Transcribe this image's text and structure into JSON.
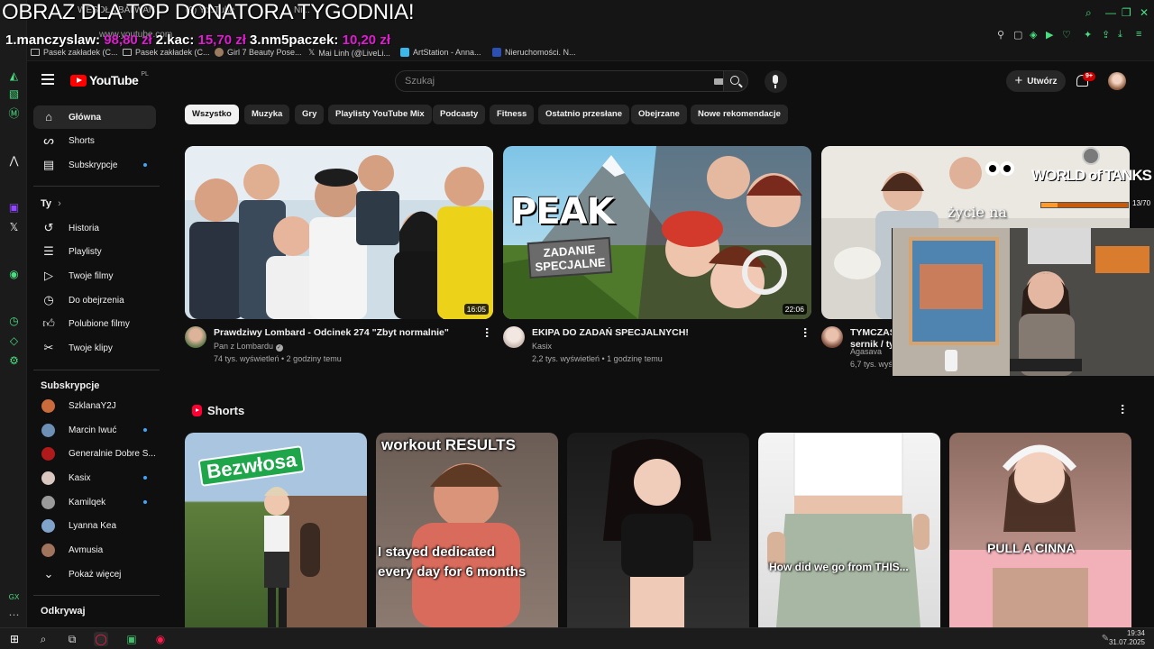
{
  "overlay": {
    "title": "OBRAZ DLA TOP DONATORA TYGODNIA!",
    "donors": [
      {
        "rank": "1.",
        "name": "manczyslaw:",
        "amount": "98,80 zł"
      },
      {
        "rank": "2.",
        "name": "kac:",
        "amount": "15,70 zł"
      },
      {
        "rank": "3.",
        "name": "nm5paczek:",
        "amount": "10,20 zł"
      }
    ]
  },
  "browser": {
    "url": "www.youtube.com",
    "tabs": [
      "WESOŁA BALWAN",
      "(9) YouTube",
      "Ni..."
    ],
    "bookmarks": [
      {
        "label": "Pasek zakładek (C...",
        "icon": "folder-icon"
      },
      {
        "label": "Pasek zakładek (C...",
        "icon": "folder-icon"
      },
      {
        "label": "Girl 7 Beauty Pose...",
        "icon": "site-icon"
      },
      {
        "label": "Mai Linh (@LiveLi...",
        "icon": "x-icon"
      },
      {
        "label": "ArtStation - Anna...",
        "icon": "artstation-icon"
      },
      {
        "label": "Nieruchomości. N...",
        "icon": "m-icon"
      }
    ]
  },
  "header": {
    "logo_text": "YouTube",
    "country": "PL",
    "search_placeholder": "Szukaj",
    "create_label": "Utwórz",
    "notif_badge": "9+"
  },
  "sidebar": {
    "main": [
      {
        "label": "Główna",
        "icon": "home-icon",
        "active": true
      },
      {
        "label": "Shorts",
        "icon": "shorts-icon"
      },
      {
        "label": "Subskrypcje",
        "icon": "subscriptions-icon",
        "dot": true
      }
    ],
    "you_heading": "Ty",
    "you": [
      {
        "label": "Historia",
        "icon": "history-icon"
      },
      {
        "label": "Playlisty",
        "icon": "playlist-icon"
      },
      {
        "label": "Twoje filmy",
        "icon": "your-videos-icon"
      },
      {
        "label": "Do obejrzenia",
        "icon": "watch-later-icon"
      },
      {
        "label": "Polubione filmy",
        "icon": "like-icon"
      },
      {
        "label": "Twoje klipy",
        "icon": "clips-icon"
      }
    ],
    "subs_heading": "Subskrypcje",
    "subs": [
      {
        "label": "SzklanaY2J",
        "color": "#c96b3b"
      },
      {
        "label": "Marcin Iwuć",
        "color": "#6e8fb5",
        "dot": true
      },
      {
        "label": "Generalnie Dobre S...",
        "color": "#b11a1a"
      },
      {
        "label": "Kasix",
        "color": "#d9c7c0",
        "dot": true
      },
      {
        "label": "Kamilqek",
        "color": "#9a9a9a",
        "dot": true
      },
      {
        "label": "Lyanna Kea",
        "color": "#7fa3c9"
      },
      {
        "label": "Avmusia",
        "color": "#a0735c"
      }
    ],
    "show_more": "Pokaż więcej",
    "explore_heading": "Odkrywaj"
  },
  "chips": [
    "Wszystko",
    "Muzyka",
    "Gry",
    "Playlisty YouTube Mix",
    "Podcasty",
    "Fitness",
    "Ostatnio przesłane",
    "Obejrzane",
    "Nowe rekomendacje"
  ],
  "videos": [
    {
      "title": "Prawdziwy Lombard - Odcinek 274 \"Zbyt normalnie\"",
      "channel": "Pan z Lombardu",
      "verified": true,
      "stats": "74 tys. wyświetleń • 2 godziny temu",
      "duration": "16:05"
    },
    {
      "title": "EKIPA DO ZADAŃ SPECJALNYCH!",
      "channel": "Kasix",
      "stats": "2,2 tys. wyświetleń • 1 godzinę temu",
      "duration": "22:06",
      "thumb_text_1": "PEAK",
      "thumb_text_2": "ZADANIE SPECJALNE"
    },
    {
      "title": "TYMCZAS",
      "title_line2": "sernik / ty",
      "channel": "Agasava",
      "stats": "6,7 tys. wyświetleń • 2 godziny temu",
      "thumb_text": "życie na"
    }
  ],
  "shorts": {
    "heading": "Shorts",
    "items": [
      {
        "caption": "Bezwłosa"
      },
      {
        "caption": "workout RESULTS",
        "caption2": "I stayed dedicated",
        "caption3": "every day for 6 months"
      },
      {
        "caption": ""
      },
      {
        "caption": "How did we go from THIS..."
      },
      {
        "caption": "PULL A CINNA"
      }
    ]
  },
  "game_overlay": {
    "title": "WORLD of TANKS",
    "counter": "13/70",
    "progress": 0.19
  },
  "taskbar": {
    "time": "19:34",
    "date": "31.07.2025"
  }
}
